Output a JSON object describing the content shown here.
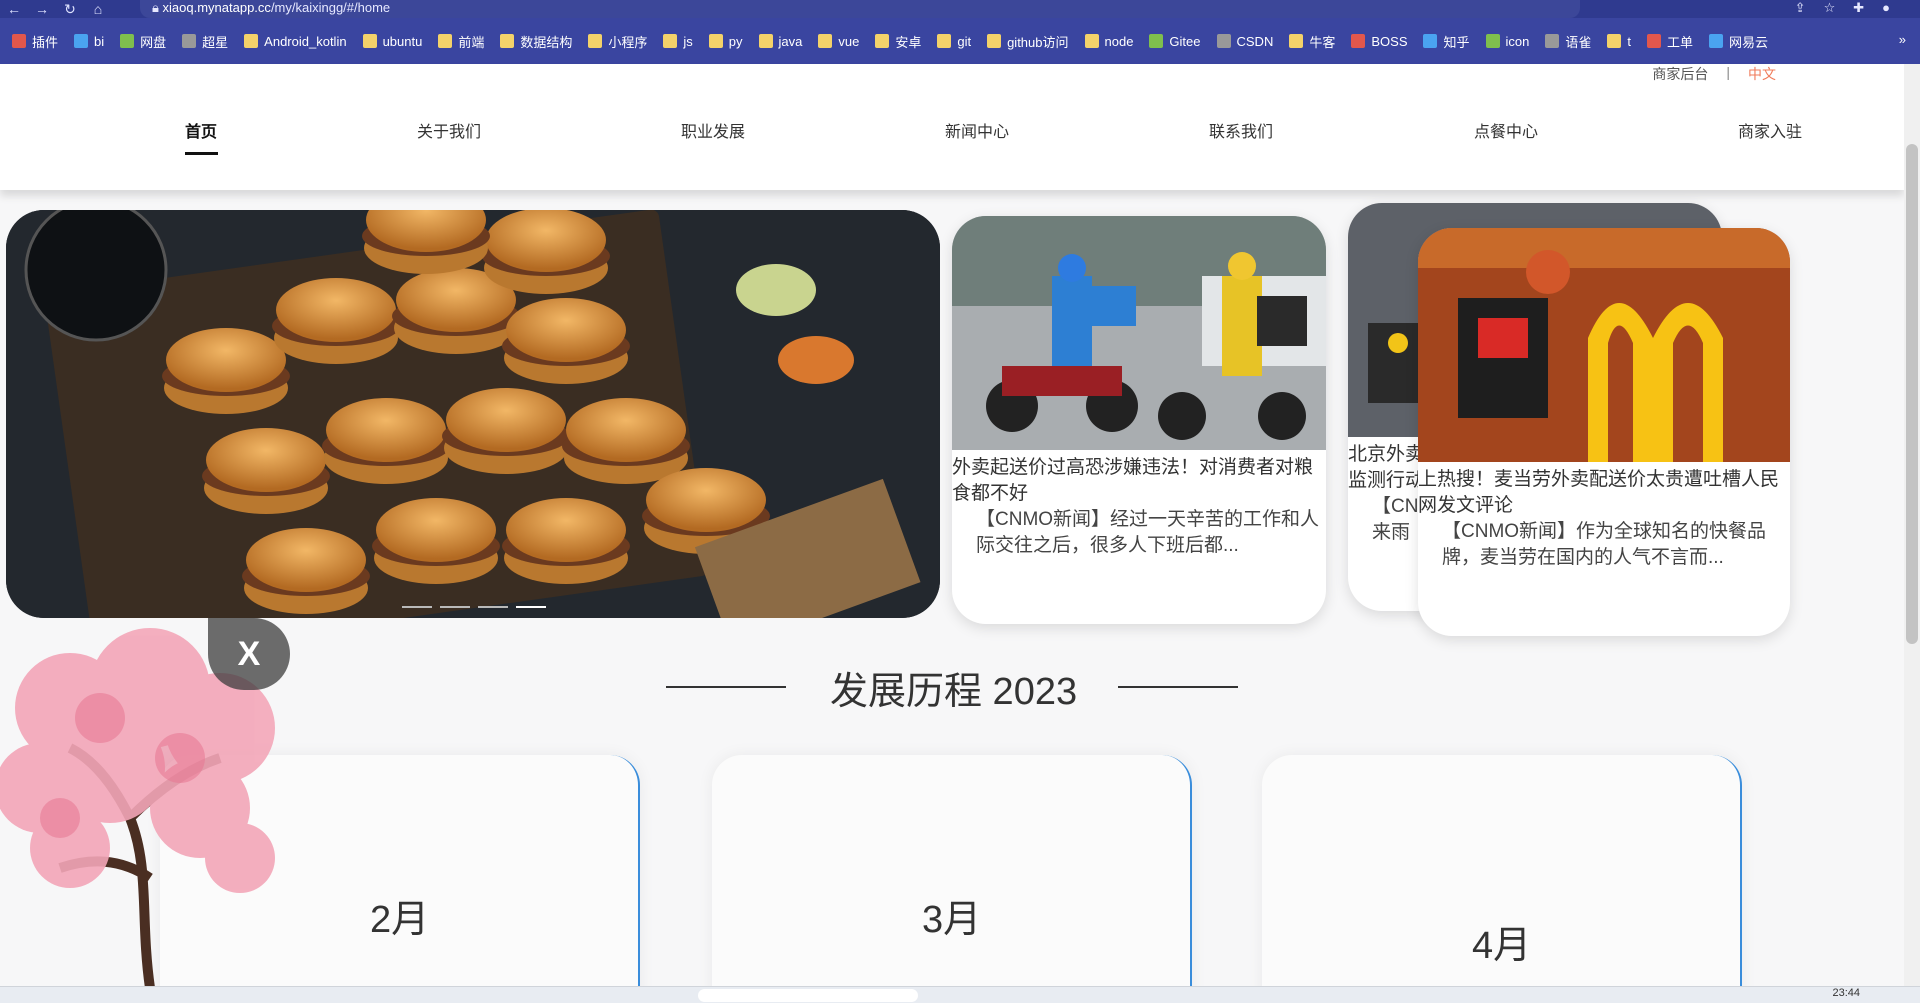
{
  "browser": {
    "url_host": "xiaoq.mynatapp.cc",
    "url_path": "/my/kaixingg/#/home",
    "bookmarks": [
      "插件",
      "bi",
      "网盘",
      "超星",
      "Android_kotlin",
      "ubuntu",
      "前端",
      "数据结构",
      "小程序",
      "js",
      "py",
      "java",
      "vue",
      "安卓",
      "git",
      "github访问",
      "node",
      "Gitee",
      "CSDN",
      "牛客",
      "BOSS",
      "知乎",
      "icon",
      "语雀",
      "t",
      "工单",
      "网易云"
    ],
    "more": "»"
  },
  "header": {
    "admin_link": "商家后台",
    "separator": "|",
    "lang_link": "中文",
    "nav": [
      "首页",
      "关于我们",
      "职业发展",
      "新闻中心",
      "联系我们",
      "点餐中心",
      "商家入驻"
    ]
  },
  "carousel": {
    "active_index": 3,
    "dot_count": 4
  },
  "news": [
    {
      "title": "外卖起送价过高恐涉嫌违法！对消费者对粮食都不好",
      "desc": "【CNMO新闻】经过一天辛苦的工作和人际交往之后，很多人下班后都..."
    },
    {
      "title": "北京外卖",
      "title2": "监测行动",
      "desc": "【CN",
      "desc2": "来雨"
    },
    {
      "title": "上热搜！麦当劳外卖配送价太贵遭吐槽人民网发文评论",
      "desc": "【CNMO新闻】作为全球知名的快餐品牌，麦当劳在国内的人气不言而..."
    }
  ],
  "history": {
    "title": "发展历程 2023",
    "months": [
      "2月",
      "3月",
      "4月"
    ]
  },
  "close_label": "X",
  "taskbar": {
    "time": "23:44"
  },
  "colors": {
    "chrome": "#2f3a8f",
    "accent_lang": "#f07b5a",
    "timeline": "#3a8ddb"
  }
}
